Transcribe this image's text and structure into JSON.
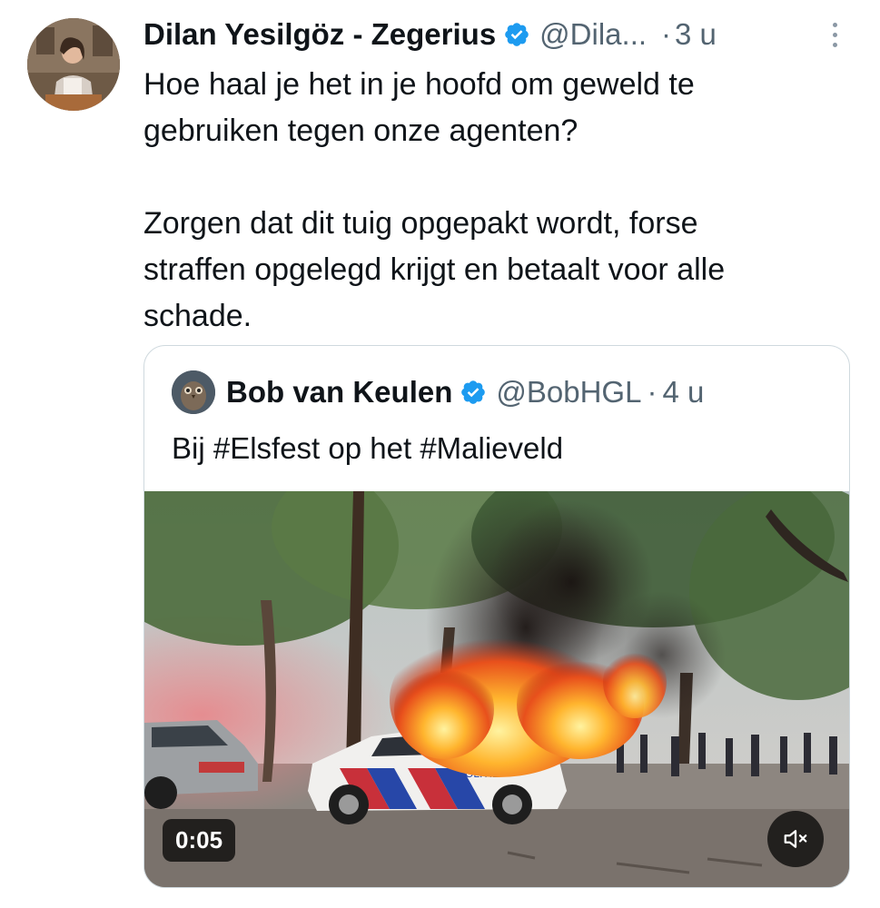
{
  "tweet": {
    "author_name": "Dilan Yesilgöz - Zegerius",
    "author_handle": "@Dila...",
    "separator": "·",
    "time": "3 u",
    "text": "Hoe haal je het in je hoofd om geweld te\ngebruiken tegen onze agenten?\n\nZorgen dat dit tuig opgepakt wordt, forse\nstraffen opgelegd krijgt en betaalt voor alle\nschade."
  },
  "quoted_tweet": {
    "author_name": "Bob van Keulen",
    "author_handle": "@BobHGL",
    "separator": "·",
    "time": "4 u",
    "text": "Bij #Elsfest op het #Malieveld",
    "video": {
      "duration": "0:05",
      "car_lettering": "POLITIE"
    }
  },
  "colors": {
    "verified_badge": "#1d9bf0",
    "primary_text": "#0f1419",
    "secondary_text": "#536471",
    "border": "#cfd9de"
  },
  "icons": [
    "more-options-icon",
    "verified-badge-icon",
    "mute-icon"
  ]
}
